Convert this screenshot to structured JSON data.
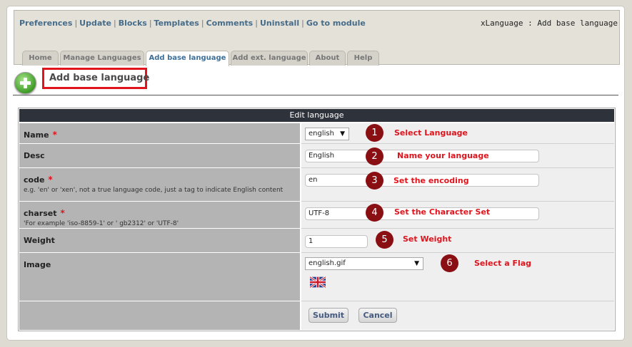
{
  "nav": {
    "links": [
      "Preferences",
      "Update",
      "Blocks",
      "Templates",
      "Comments",
      "Uninstall",
      "Go to module"
    ],
    "separator": "|"
  },
  "breadcrumb": "xLanguage : Add base language",
  "tabs": [
    "Home",
    "Manage Languages",
    "Add base language",
    "Add ext. language",
    "About",
    "Help"
  ],
  "active_tab": "Add base language",
  "page_title": "Add base language",
  "form": {
    "header": "Edit language",
    "required_mark": "*",
    "fields": {
      "name": {
        "label": "Name",
        "value": "english",
        "step": "1",
        "note": "Select Language"
      },
      "desc": {
        "label": "Desc",
        "value": "English",
        "step": "2",
        "note": "Name your language"
      },
      "code": {
        "label": "code",
        "description": "e.g. 'en' or 'xen', not a true language code, just a tag to indicate English content",
        "value": "en",
        "step": "3",
        "note": "Set the encoding"
      },
      "charset": {
        "label": "charset",
        "description": "'For example 'iso-8859-1' or ' gb2312' or 'UTF-8'",
        "value": "UTF-8",
        "step": "4",
        "note": "Set the Character Set"
      },
      "weight": {
        "label": "Weight",
        "value": "1",
        "step": "5",
        "note": "Set Weight"
      },
      "image": {
        "label": "Image",
        "value": "english.gif",
        "step": "6",
        "note": "Select a Flag",
        "flag_icon": "uk-flag-icon"
      }
    },
    "submit_label": "Submit",
    "cancel_label": "Cancel"
  },
  "colors": {
    "accent_red": "#e0141d",
    "step_circle": "#8a0f13",
    "link_blue": "#466c8a",
    "header_bar": "#2e323a"
  }
}
